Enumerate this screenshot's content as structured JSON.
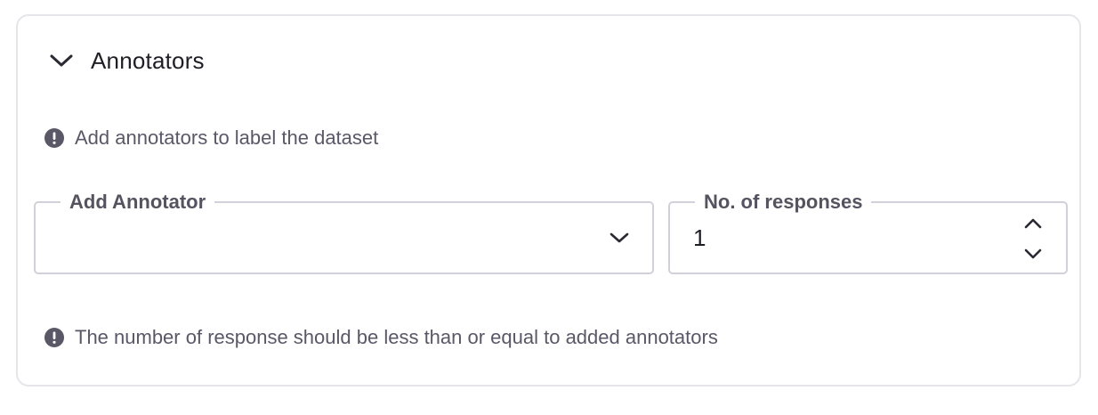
{
  "section": {
    "title": "Annotators",
    "expanded": true
  },
  "info": {
    "top_message": "Add annotators to label the dataset",
    "bottom_message": "The number of response should be less than or equal to added annotators"
  },
  "annotator_field": {
    "label": "Add Annotator",
    "value": ""
  },
  "responses_field": {
    "label": "No. of responses",
    "value": "1"
  },
  "icons": {
    "toggle": "chevron-down-icon",
    "info": "info-icon",
    "dropdown": "chevron-down-icon",
    "increment": "chevron-up-icon",
    "decrement": "chevron-down-icon"
  },
  "colors": {
    "border": "#e6e5ea",
    "field_border": "#d2d0d8",
    "info_icon": "#5a5866",
    "text_primary": "#1f1d26",
    "text_secondary": "#5a5866"
  }
}
